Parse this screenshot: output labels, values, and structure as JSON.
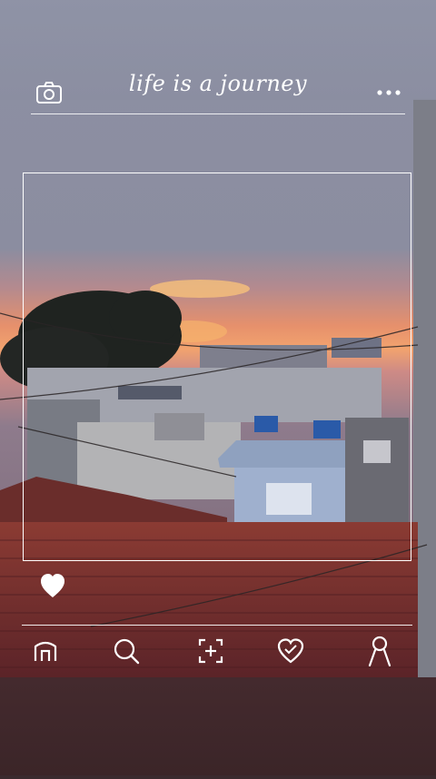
{
  "header": {
    "title": "life is a journey",
    "left_icon": "camera-icon",
    "right_icon": "more-dots-icon"
  },
  "photo": {
    "subject": "",
    "like_icon": "heart-filled-icon"
  },
  "nav": {
    "items": [
      {
        "icon": "home-icon"
      },
      {
        "icon": "search-icon"
      },
      {
        "icon": "add-post-icon"
      },
      {
        "icon": "heart-outline-icon"
      },
      {
        "icon": "profile-icon"
      }
    ]
  },
  "colors": {
    "accent": "#ffffff",
    "sky_top": "#8d8fa1",
    "sunset": "#e98a5a"
  }
}
